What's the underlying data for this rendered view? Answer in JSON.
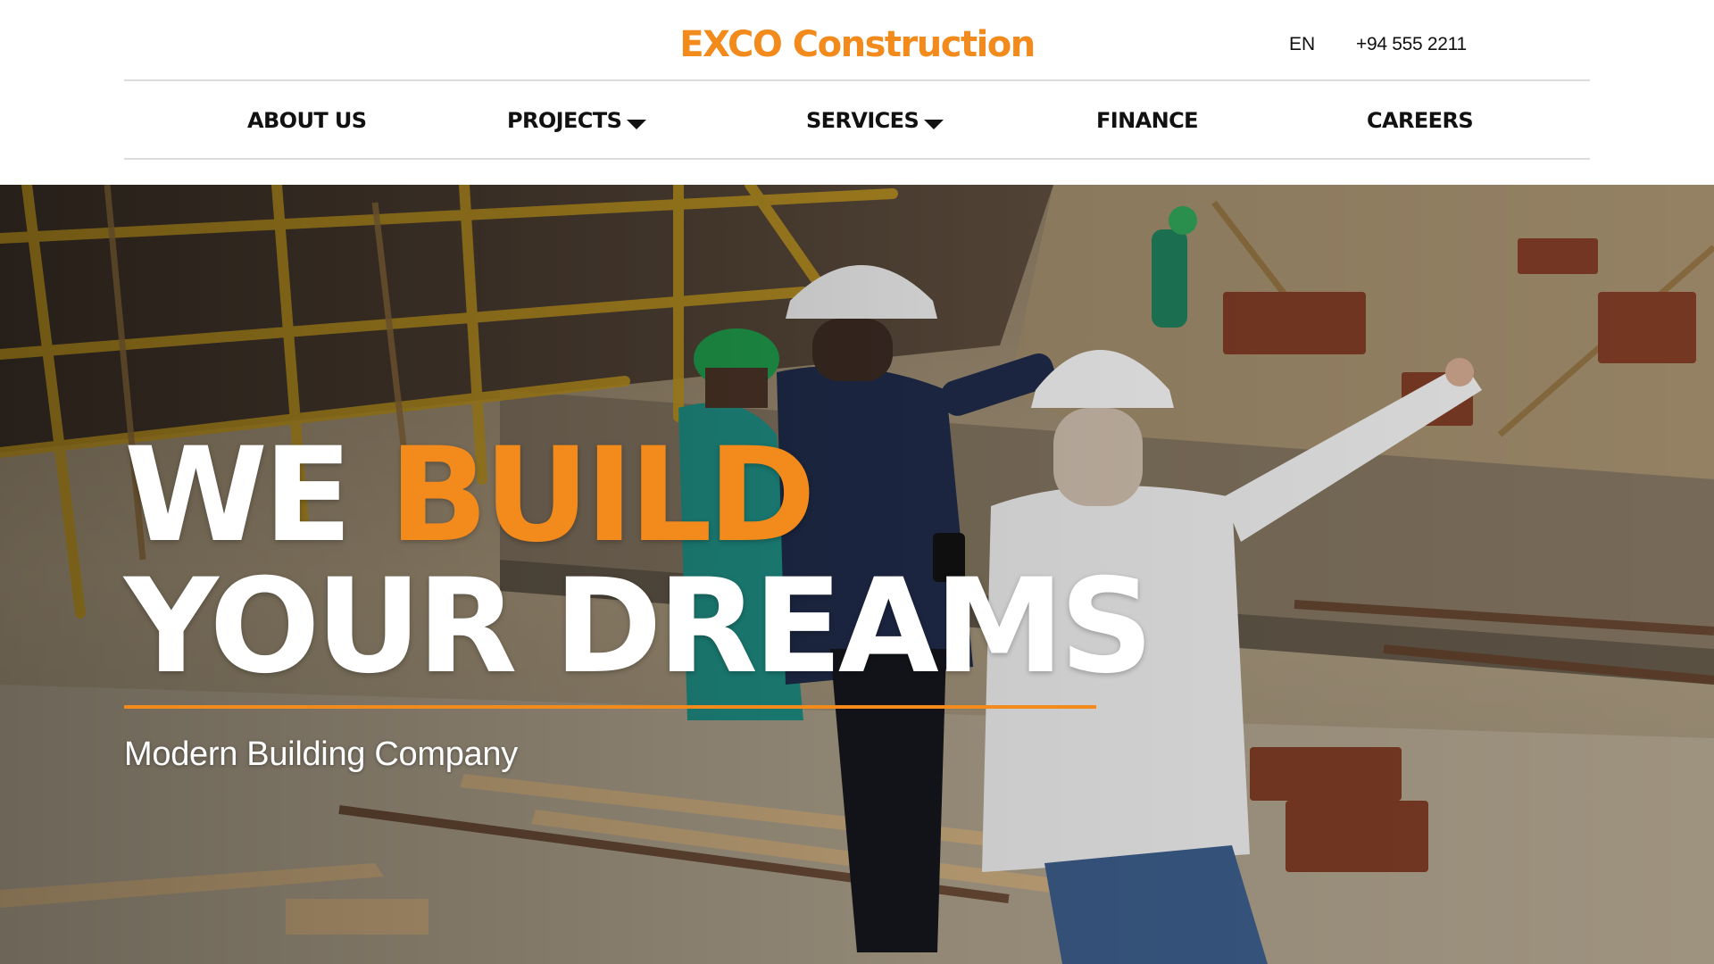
{
  "header": {
    "logo": "EXCO Construction",
    "language": "EN",
    "phone": "+94 555 2211"
  },
  "nav": {
    "about": "ABOUT US",
    "projects": "PROJECTS",
    "services": "SERVICES",
    "finance": "FINANCE",
    "careers": "CAREERS"
  },
  "hero": {
    "headline_word1": "WE",
    "headline_word2": "BUILD",
    "headline_line2": "YOUR DREAMS",
    "subtitle": "Modern Building Company"
  },
  "colors": {
    "accent": "#f28a1c",
    "nav_text": "#111111",
    "hero_text": "#ffffff"
  },
  "icons": {
    "dropdown": "caret-down-icon"
  }
}
